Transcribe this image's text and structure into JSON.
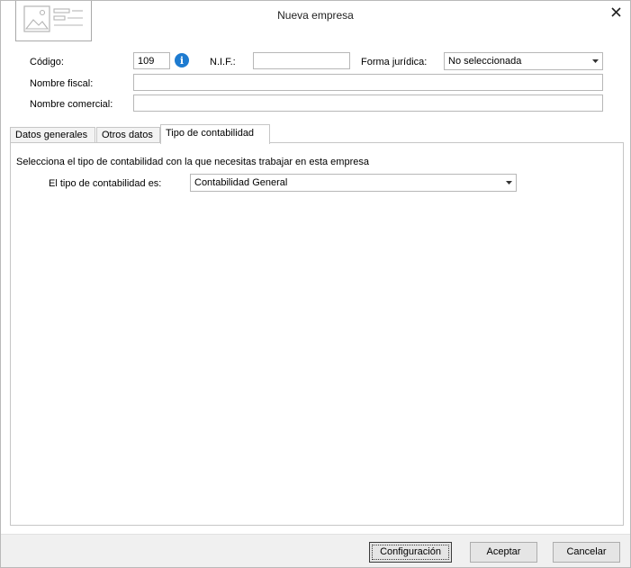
{
  "window": {
    "title": "Nueva empresa"
  },
  "header": {
    "codigo_label": "Código:",
    "codigo_value": "109",
    "nif_label": "N.I.F.:",
    "nif_value": "",
    "forma_label": "Forma jurídica:",
    "forma_value": "No seleccionada",
    "nombre_fiscal_label": "Nombre fiscal:",
    "nombre_fiscal_value": "",
    "nombre_comercial_label": "Nombre comercial:",
    "nombre_comercial_value": ""
  },
  "tabs": [
    {
      "label": "Datos generales"
    },
    {
      "label": "Otros datos"
    },
    {
      "label": "Tipo de contabilidad"
    }
  ],
  "panel": {
    "description": "Selecciona el tipo de contabilidad con la que necesitas trabajar en esta empresa",
    "tipo_label": "El tipo de contabilidad es:",
    "tipo_value": "Contabilidad General"
  },
  "footer": {
    "config_label": "Configuración",
    "accept_label": "Aceptar",
    "cancel_label": "Cancelar"
  },
  "colors": {
    "info_icon": "#1e7bd0",
    "footer_bg": "#f0f0f0",
    "button_bg": "#e5e5e5"
  }
}
